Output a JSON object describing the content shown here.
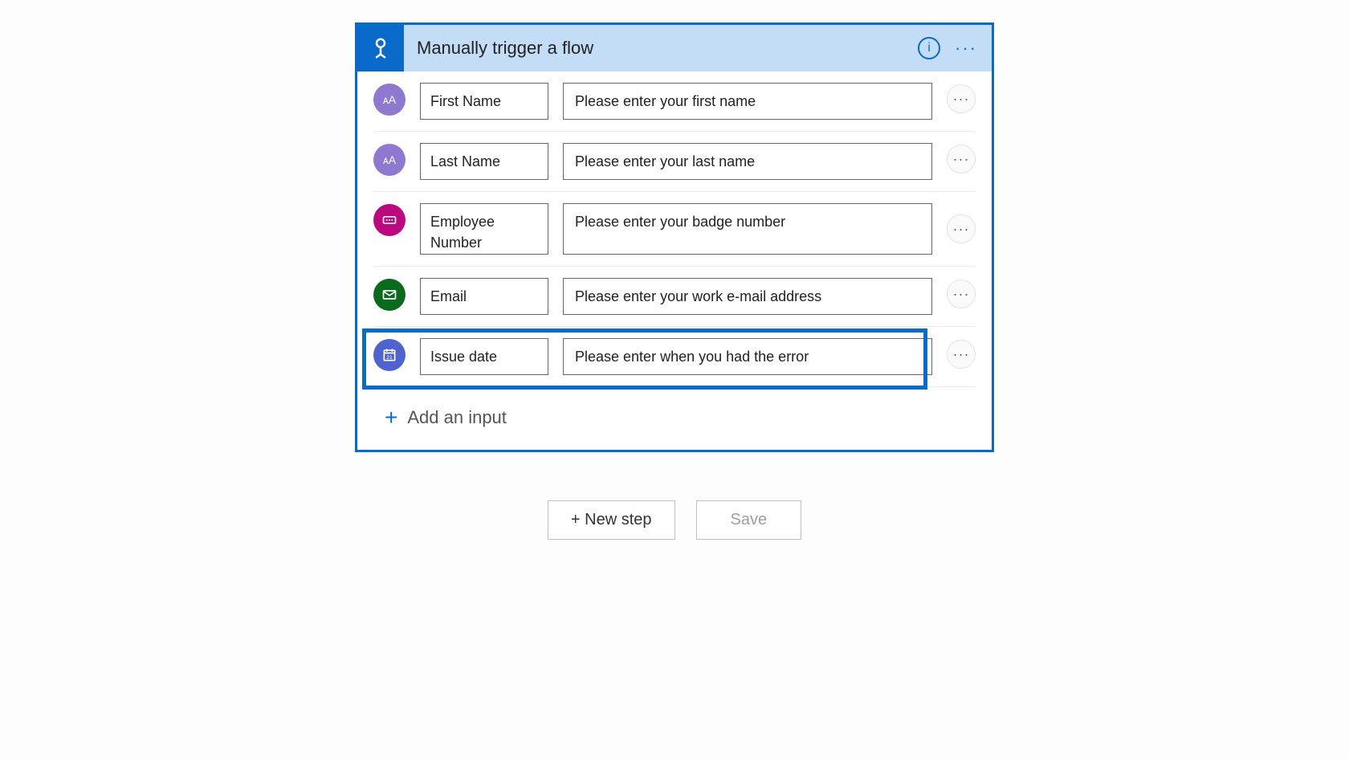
{
  "card": {
    "title": "Manually trigger a flow"
  },
  "inputs": [
    {
      "name": "First Name",
      "description": "Please enter your first name"
    },
    {
      "name": "Last Name",
      "description": "Please enter your last name"
    },
    {
      "name": "Employee Number",
      "description": "Please enter your badge number"
    },
    {
      "name": "Email",
      "description": "Please enter your work e-mail address"
    },
    {
      "name": "Issue date",
      "description": "Please enter when you had the error"
    }
  ],
  "addLabel": "Add an input",
  "footer": {
    "newStep": "+ New step",
    "save": "Save"
  }
}
